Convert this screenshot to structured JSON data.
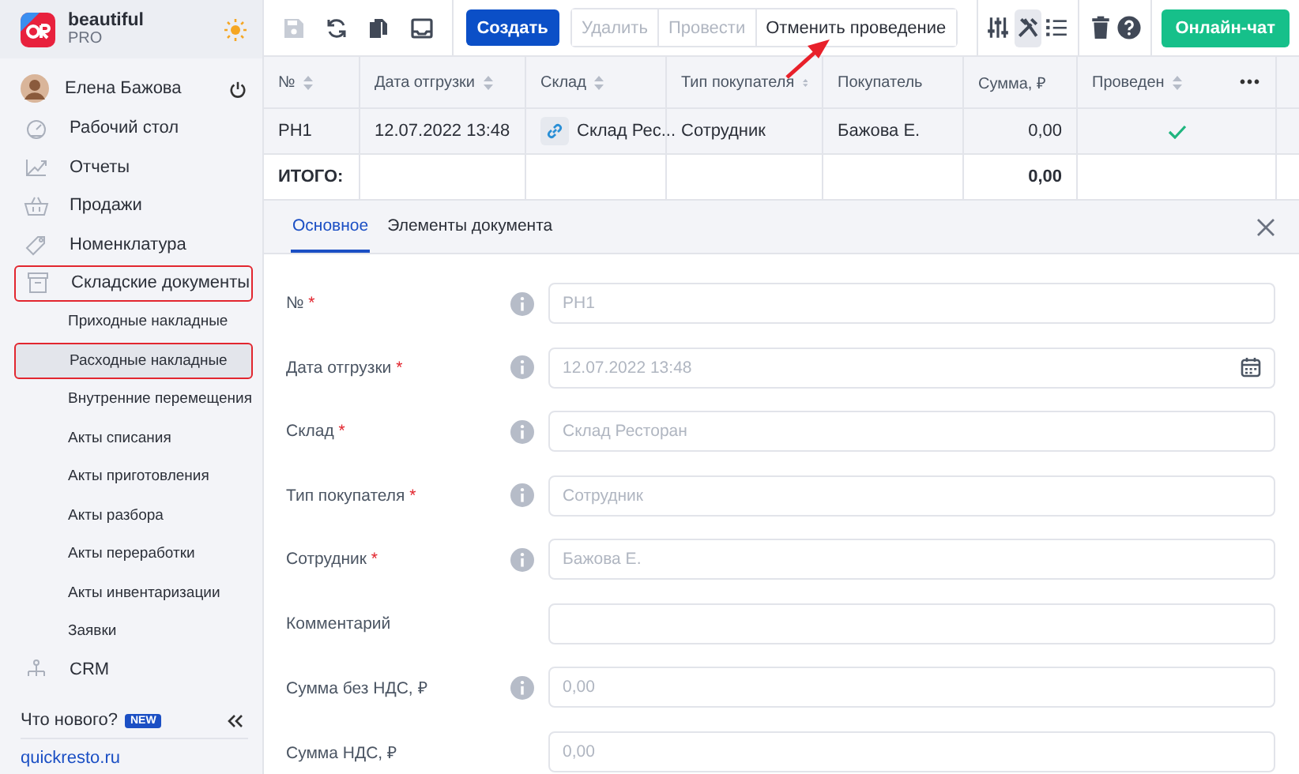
{
  "brand": {
    "name": "beautiful",
    "plan": "PRO"
  },
  "user": {
    "name": "Елена Бажова"
  },
  "sidebar": {
    "items": [
      {
        "label": "Рабочий стол",
        "kind": "gauge",
        "selected": false,
        "highlighted": false
      },
      {
        "label": "Отчеты",
        "kind": "chart",
        "selected": false,
        "highlighted": false
      },
      {
        "label": "Продажи",
        "kind": "basket",
        "selected": false,
        "highlighted": false
      },
      {
        "label": "Номенклатура",
        "kind": "tag",
        "selected": false,
        "highlighted": false
      },
      {
        "label": "Складские документы",
        "kind": "box",
        "selected": false,
        "highlighted": true,
        "children": [
          {
            "label": "Приходные накладные",
            "selected": false,
            "highlighted": false
          },
          {
            "label": "Расходные накладные",
            "selected": true,
            "highlighted": true
          },
          {
            "label": "Внутренние перемещения",
            "selected": false,
            "highlighted": false
          },
          {
            "label": "Акты списания",
            "selected": false,
            "highlighted": false
          },
          {
            "label": "Акты приготовления",
            "selected": false,
            "highlighted": false
          },
          {
            "label": "Акты разбора",
            "selected": false,
            "highlighted": false
          },
          {
            "label": "Акты переработки",
            "selected": false,
            "highlighted": false
          },
          {
            "label": "Акты инвентаризации",
            "selected": false,
            "highlighted": false
          },
          {
            "label": "Заявки",
            "selected": false,
            "highlighted": false
          }
        ]
      },
      {
        "label": "CRM",
        "kind": "tree",
        "selected": false,
        "highlighted": false
      }
    ]
  },
  "footer": {
    "whats_new": "Что нового?",
    "badge": "NEW",
    "link": "quickresto.ru"
  },
  "toolbar": {
    "icon_buttons": [
      {
        "kind": "save",
        "disabled": true,
        "selected": false
      },
      {
        "kind": "refresh",
        "disabled": false,
        "selected": false
      },
      {
        "kind": "copy",
        "disabled": false,
        "selected": false
      },
      {
        "kind": "tray",
        "disabled": false,
        "selected": false
      }
    ],
    "create": "Создать",
    "actions": [
      {
        "label": "Удалить",
        "disabled": true,
        "pointed": false
      },
      {
        "label": "Провести",
        "disabled": true,
        "pointed": false
      },
      {
        "label": "Отменить проведение",
        "disabled": false,
        "pointed": true
      }
    ],
    "right_buttons": [
      {
        "kind": "sliders",
        "disabled": false,
        "selected": false
      },
      {
        "kind": "tools",
        "disabled": false,
        "selected": true
      },
      {
        "kind": "list",
        "disabled": false,
        "selected": false
      },
      {
        "kind": "trash",
        "disabled": false,
        "selected": false
      },
      {
        "kind": "help",
        "disabled": false,
        "selected": false
      }
    ],
    "chat": "Онлайн-чат"
  },
  "table": {
    "columns": [
      {
        "label": "№",
        "sortable": true,
        "kind": "text"
      },
      {
        "label": "Дата отгрузки",
        "sortable": true,
        "kind": "text"
      },
      {
        "label": "Склад",
        "sortable": true,
        "kind": "link"
      },
      {
        "label": "Тип покупателя",
        "sortable": true,
        "kind": "text"
      },
      {
        "label": "Покупатель",
        "sortable": false,
        "kind": "text"
      },
      {
        "label": "Сумма, ₽",
        "sortable": false,
        "kind": "number"
      },
      {
        "label": "Проведен",
        "sortable": true,
        "kind": "check"
      }
    ],
    "more": "•••",
    "rows": [
      {
        "cells": [
          "РН1",
          "12.07.2022 13:48",
          "Склад Рес...",
          "Сотрудник",
          "Бажова Е.",
          "0,00"
        ],
        "posted": true,
        "selected": true
      }
    ],
    "total": {
      "label": "ИТОГО:",
      "sum": "0,00"
    }
  },
  "tabs": [
    {
      "label": "Основное",
      "selected": true
    },
    {
      "label": "Элементы документа",
      "selected": false
    }
  ],
  "form": {
    "required_mark": "*",
    "fields": [
      {
        "label": "№",
        "required": true,
        "info": true,
        "value": "РН1",
        "kind": "text"
      },
      {
        "label": "Дата отгрузки",
        "required": true,
        "info": true,
        "value": "12.07.2022 13:48",
        "kind": "date"
      },
      {
        "label": "Склад",
        "required": true,
        "info": true,
        "value": "Склад Ресторан",
        "kind": "text"
      },
      {
        "label": "Тип покупателя",
        "required": true,
        "info": true,
        "value": "Сотрудник",
        "kind": "text"
      },
      {
        "label": "Сотрудник",
        "required": true,
        "info": true,
        "value": "Бажова Е.",
        "kind": "text"
      },
      {
        "label": "Комментарий",
        "required": false,
        "info": false,
        "kind": "text"
      },
      {
        "label": "Сумма без НДС, ₽",
        "required": false,
        "info": true,
        "value": "0,00",
        "kind": "text"
      },
      {
        "label": "Сумма НДС, ₽",
        "required": false,
        "info": false,
        "value": "0,00",
        "kind": "text"
      }
    ]
  }
}
